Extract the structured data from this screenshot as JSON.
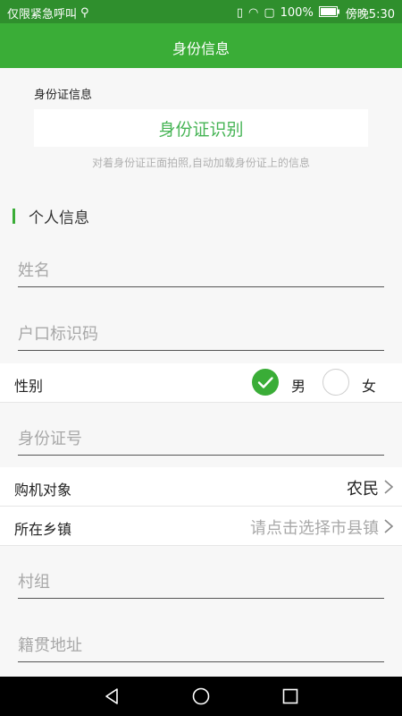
{
  "status_bar": {
    "carrier": "仅限紧急呼叫",
    "battery": "100%",
    "time": "傍晚5:30"
  },
  "app_bar": {
    "title": "身份信息"
  },
  "id_card": {
    "label": "身份证信息",
    "button": "身份证识别",
    "hint": "对着身份证正面拍照,自动加载身份证上的信息"
  },
  "personal_info": {
    "title": "个人信息",
    "name_placeholder": "姓名",
    "household_placeholder": "户口标识码",
    "gender_label": "性别",
    "gender_options": [
      {
        "label": "男",
        "checked": true
      },
      {
        "label": "女",
        "checked": false
      }
    ],
    "id_number_placeholder": "身份证号",
    "buyer_type_label": "购机对象",
    "buyer_type_value": "农民",
    "township_label": "所在乡镇",
    "township_placeholder": "请点击选择市县镇",
    "village_placeholder": "村组",
    "native_address_placeholder": "籍贯地址"
  },
  "colors": {
    "primary": "#3aad37",
    "status_bar": "#2f8f2d",
    "accent_text": "#46b455",
    "hint_text": "#b0b0b0"
  }
}
